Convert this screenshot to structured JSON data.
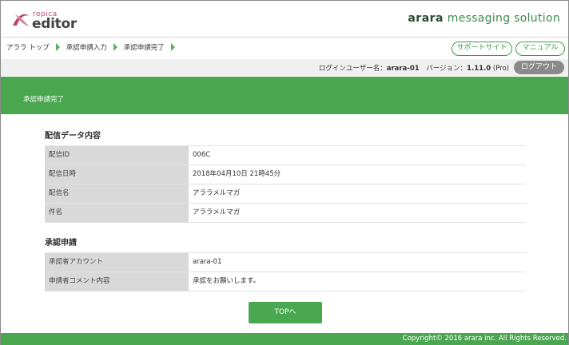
{
  "header": {
    "logo_sub": "repica",
    "logo_main": "editor",
    "brand_bold": "arara",
    "brand_rest": " messaging solution"
  },
  "breadcrumb": {
    "items": [
      "アララ トップ",
      "承認申請入力",
      "承認申請完了"
    ]
  },
  "nav": {
    "support_label": "サポートサイト",
    "manual_label": "マニュアル"
  },
  "userbar": {
    "login_prefix": "ログインユーザー名：",
    "login_user": "arara-01",
    "version_prefix": "　バージョン：",
    "version": "1.11.0",
    "version_suffix": " (Pro)",
    "logout_label": "ログアウト"
  },
  "page_title": "承認申請完了",
  "delivery_section": {
    "title": "配信データ内容",
    "rows": [
      {
        "label": "配信ID",
        "value": "006C"
      },
      {
        "label": "配信日時",
        "value": "2018年04月10日 21時45分"
      },
      {
        "label": "配信名",
        "value": "アララメルマガ"
      },
      {
        "label": "件名",
        "value": "アララメルマガ"
      }
    ]
  },
  "approval_section": {
    "title": "承認申請",
    "rows": [
      {
        "label": "承認者アカウント",
        "value": "arara-01"
      },
      {
        "label": "申請者コメント内容",
        "value": "承認をお願いします。"
      }
    ]
  },
  "top_button_label": "TOPへ",
  "footer_text": "Copyright© 2016 arara inc. All Rights Reserved.",
  "colors": {
    "accent_green": "#4aa750",
    "label_gray": "#d9d9d9",
    "logout_gray": "#8a8a8a"
  },
  "icons": {
    "logo": "repica-swirl-icon",
    "crumb_separator": "triangle-right-icon"
  }
}
